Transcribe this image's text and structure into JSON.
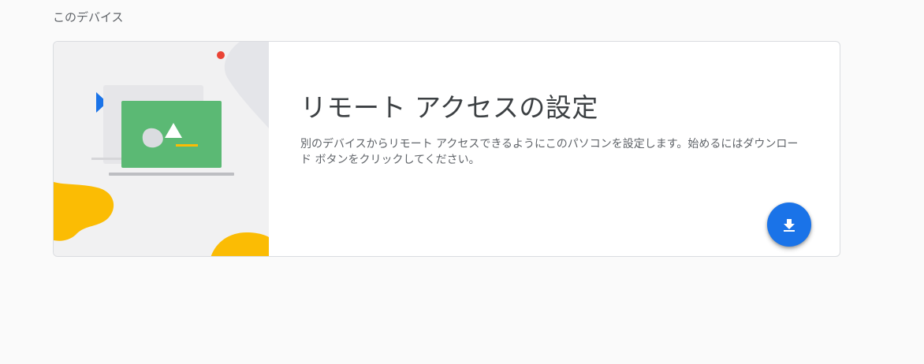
{
  "section": {
    "title": "このデバイス"
  },
  "card": {
    "title": "リモート アクセスの設定",
    "description": "別のデバイスからリモート アクセスできるようにこのパソコンを設定します。始めるにはダウンロード ボタンをクリックしてください。",
    "download_button_icon": "download-icon",
    "illustration_icon": "laptop-illustration"
  },
  "colors": {
    "accent": "#1a73e8",
    "laptop_screen": "#5bb974",
    "blob": "#fbbc04",
    "dot": "#ea4335",
    "page_bg": "#fafafa"
  }
}
